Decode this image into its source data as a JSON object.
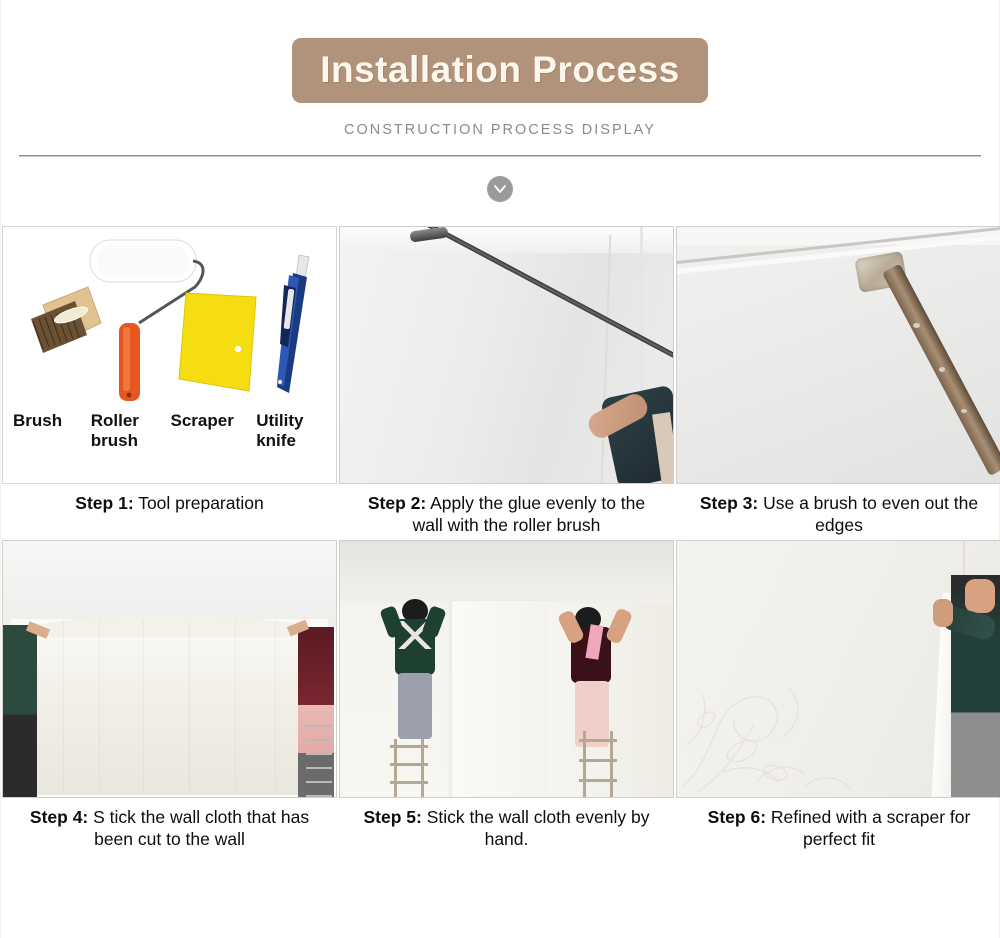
{
  "header": {
    "title": "Installation Process",
    "subtitle": "CONSTRUCTION PROCESS DISPLAY",
    "badge_color": "#b0937a",
    "subtitle_color": "#8b8b8b",
    "chevron_icon": "chevron-down-icon",
    "chevron_color": "#9a9a9a"
  },
  "tools": [
    {
      "label": "Brush",
      "icon": "wire-brush-icon"
    },
    {
      "label": "Roller\nbrush",
      "line1": "Roller",
      "line2": "brush",
      "icon": "paint-roller-icon"
    },
    {
      "label": "Scraper",
      "icon": "scraper-icon"
    },
    {
      "label": "Utility\nknife",
      "line1": "Utility",
      "line2": "knife",
      "icon": "utility-knife-icon"
    }
  ],
  "steps": [
    {
      "number": "Step 1:",
      "text": "Tool preparation",
      "caption_line1": "Step 1: Tool preparation",
      "caption_line2": "",
      "image_alt": "installation-tools-photo"
    },
    {
      "number": "Step 2:",
      "text": "Apply the glue evenly to the wall with the roller brush",
      "caption_line1": "Apply the glue evenly to",
      "caption_line2": "the wall with the roller brush",
      "image_alt": "roller-applying-glue-photo"
    },
    {
      "number": "Step 3:",
      "text": "Use a brush to even out the edges",
      "caption_line1": "Use a brush to even out",
      "caption_line2": "the edges",
      "image_alt": "brush-evening-edges-photo"
    },
    {
      "number": "Step 4:",
      "text": "S tick the wall cloth that has been cut to the wall",
      "caption_line1": "S tick the wall cloth that",
      "caption_line2": "has been cut to the wall",
      "image_alt": "hanging-wall-cloth-photo"
    },
    {
      "number": "Step 5:",
      "text": "Stick the wall cloth evenly by hand.",
      "caption_line1": "Stick the wall cloth",
      "caption_line2": "evenly by hand.",
      "image_alt": "workers-on-ladders-photo"
    },
    {
      "number": "Step 6:",
      "text": "Refined with a scraper for perfect fit",
      "caption_line1": "Refined with a scraper",
      "caption_line2": "for perfect fit",
      "image_alt": "scraper-refining-photo"
    }
  ]
}
